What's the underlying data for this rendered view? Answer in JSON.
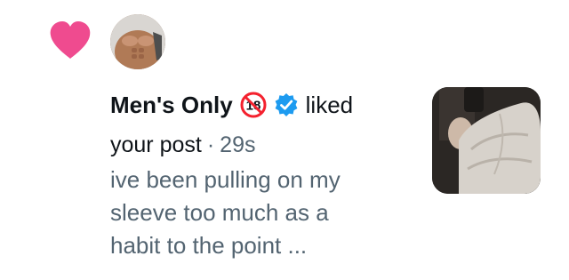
{
  "notification": {
    "account_name": "Men's Only",
    "age_badge_text": "18",
    "action_text": "liked",
    "object_text": "your post",
    "separator": "·",
    "time_ago": "29s",
    "preview_lines": [
      "ive been pulling on my",
      "sleeve too much as a",
      "habit to the point ..."
    ],
    "icons": {
      "reaction": "heart-icon",
      "verified": "verified-badge-icon",
      "age_badge": "age-18-badge-icon"
    },
    "colors": {
      "heart": "#ef4b8f",
      "verified": "#1d9bf0",
      "age_badge_ring": "#f4212e",
      "secondary_text": "#536471",
      "primary_text": "#0f1419"
    }
  }
}
